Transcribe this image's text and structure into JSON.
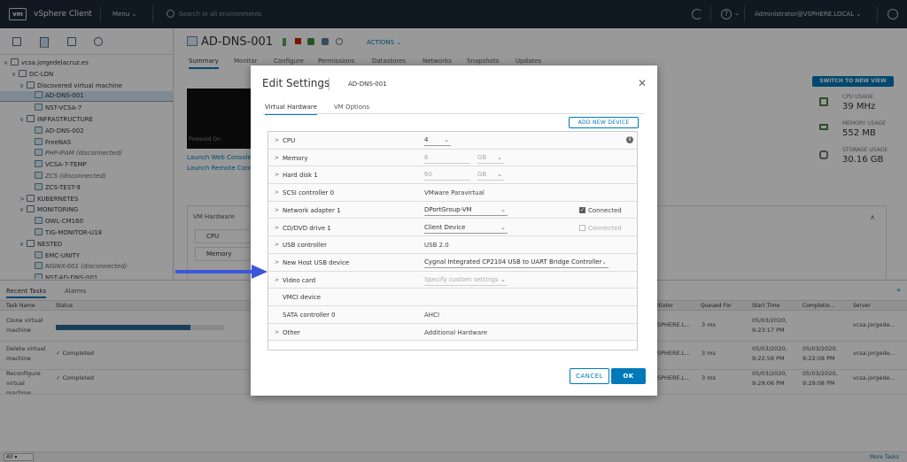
{
  "header": {
    "logo": "vm",
    "app_name": "vSphere Client",
    "menu_label": "Menu",
    "search_placeholder": "Search in all environments",
    "user": "Administrator@VSPHERE.LOCAL"
  },
  "tree": {
    "items": [
      {
        "label": "vcsa.jorgedelacruz.es",
        "indent": 0,
        "type": "vc",
        "caret": "∨"
      },
      {
        "label": "DC-LON",
        "indent": 1,
        "type": "dc",
        "caret": "∨"
      },
      {
        "label": "Discovered virtual machine",
        "indent": 2,
        "type": "folder",
        "caret": "∨"
      },
      {
        "label": "AD-DNS-001",
        "indent": 3,
        "type": "vm",
        "selected": true
      },
      {
        "label": "NST-VCSA-7",
        "indent": 3,
        "type": "vm"
      },
      {
        "label": "INFRASTRUCTURE",
        "indent": 2,
        "type": "folder",
        "caret": "∨"
      },
      {
        "label": "AD-DNS-002",
        "indent": 3,
        "type": "vm"
      },
      {
        "label": "FreeNAS",
        "indent": 3,
        "type": "vm"
      },
      {
        "label": "PHP-IPAM (disconnected)",
        "indent": 3,
        "type": "vm",
        "italic": true
      },
      {
        "label": "VCSA-7-TEMP",
        "indent": 3,
        "type": "vm"
      },
      {
        "label": "ZCS (disconnected)",
        "indent": 3,
        "type": "vm",
        "italic": true
      },
      {
        "label": "ZCS-TEST-9",
        "indent": 3,
        "type": "vm"
      },
      {
        "label": "KUBERNETES",
        "indent": 2,
        "type": "folder",
        "caret": ">"
      },
      {
        "label": "MONITORING",
        "indent": 2,
        "type": "folder",
        "caret": "∨"
      },
      {
        "label": "OWL-CM160",
        "indent": 3,
        "type": "vm"
      },
      {
        "label": "TIG-MONITOR-U18",
        "indent": 3,
        "type": "vm"
      },
      {
        "label": "NESTED",
        "indent": 2,
        "type": "folder",
        "caret": "∨"
      },
      {
        "label": "EMC-UNITY",
        "indent": 3,
        "type": "vm"
      },
      {
        "label": "NGINX-001 (disconnected)",
        "indent": 3,
        "type": "vm",
        "italic": true
      },
      {
        "label": "NST-AD-DNS-001",
        "indent": 3,
        "type": "vm"
      }
    ]
  },
  "vm": {
    "name": "AD-DNS-001",
    "actions_label": "ACTIONS",
    "tabs": [
      "Summary",
      "Monitor",
      "Configure",
      "Permissions",
      "Datastores",
      "Networks",
      "Snapshots",
      "Updates"
    ],
    "console_label": "Powered On",
    "launch_web": "Launch Web Console",
    "launch_remote": "Launch Remote Console",
    "switch_view": "SWITCH TO NEW VIEW",
    "metrics": [
      {
        "label": "CPU USAGE",
        "value": "39 MHz"
      },
      {
        "label": "MEMORY USAGE",
        "value": "552 MB"
      },
      {
        "label": "STORAGE USAGE",
        "value": "30.16 GB"
      }
    ],
    "hardware_title": "VM Hardware",
    "hardware_rows": [
      "CPU",
      "Memory"
    ]
  },
  "tasks": {
    "tab_recent": "Recent Tasks",
    "tab_alarms": "Alarms",
    "columns": {
      "task_name": "Task Name",
      "status": "Status",
      "initiator": "itiator",
      "queued_for": "Queued For",
      "start_time": "Start Time",
      "completion": "Completio...",
      "server": "Server"
    },
    "rows": [
      {
        "name": [
          "Clone virtual",
          "machine"
        ],
        "status": "",
        "progress": 0.8,
        "initiator": "SPHERE.L...",
        "queued": "3 ms",
        "start": [
          "05/03/2020,",
          "9:23:17 PM"
        ],
        "completion": [
          "",
          ""
        ],
        "server": "vcsa.jorgede..."
      },
      {
        "name": [
          "Delete virtual",
          "machine"
        ],
        "status": "Completed",
        "initiator": "SPHERE.L...",
        "queued": "3 ms",
        "start": [
          "05/03/2020,",
          "9:22:58 PM"
        ],
        "completion": [
          "05/03/2020,",
          "9:22:08 PM"
        ],
        "server": "vcsa.jorgede..."
      },
      {
        "name": [
          "Reconfigure",
          "virtual",
          "machine"
        ],
        "status": "Completed",
        "initiator": "SPHERE.L...",
        "queued": "3 ms",
        "start": [
          "05/03/2020,",
          "9:29:06 PM"
        ],
        "completion": [
          "05/03/2020,",
          "9:29:08 PM"
        ],
        "server": "vcsa.jorgede..."
      }
    ],
    "footer_left": "All",
    "footer_right": "More Tasks"
  },
  "dialog": {
    "title": "Edit Settings",
    "vm_name": "AD-DNS-001",
    "tab_hardware": "Virtual Hardware",
    "tab_options": "VM Options",
    "add_device": "ADD NEW DEVICE",
    "rows": [
      {
        "caret": true,
        "name": "CPU",
        "select": "4",
        "info": true
      },
      {
        "caret": true,
        "name": "Memory",
        "input": "6",
        "unit": "GB"
      },
      {
        "caret": true,
        "name": "Hard disk 1",
        "input": "60",
        "unit": "GB"
      },
      {
        "caret": true,
        "name": "SCSI controller 0",
        "text": "VMware Paravirtual"
      },
      {
        "caret": true,
        "name": "Network adapter 1",
        "select": "DPortGroup-VM",
        "checkbox": "Connected",
        "checked": true
      },
      {
        "caret": true,
        "name": "CD/DVD drive 1",
        "select": "Client Device",
        "checkbox": "Connected",
        "checked": false
      },
      {
        "caret": true,
        "name": "USB controller",
        "text": "USB 2.0"
      },
      {
        "caret": true,
        "name": "New Host USB device",
        "select": "Cygnal Integrated CP2104 USB to UART Bridge Controller"
      },
      {
        "caret": true,
        "name": "Video card",
        "select": "Specify custom settings",
        "dim": true
      },
      {
        "caret": false,
        "name": "VMCI device",
        "text": ""
      },
      {
        "caret": false,
        "name": "SATA controller 0",
        "text": "AHCI"
      },
      {
        "caret": true,
        "name": "Other",
        "text": "Additional Hardware"
      }
    ],
    "cancel": "CANCEL",
    "ok": "OK"
  },
  "colors": {
    "accent": "#0079b8",
    "header_bg": "#1b2b3a",
    "arrow": "#3b57d9"
  }
}
